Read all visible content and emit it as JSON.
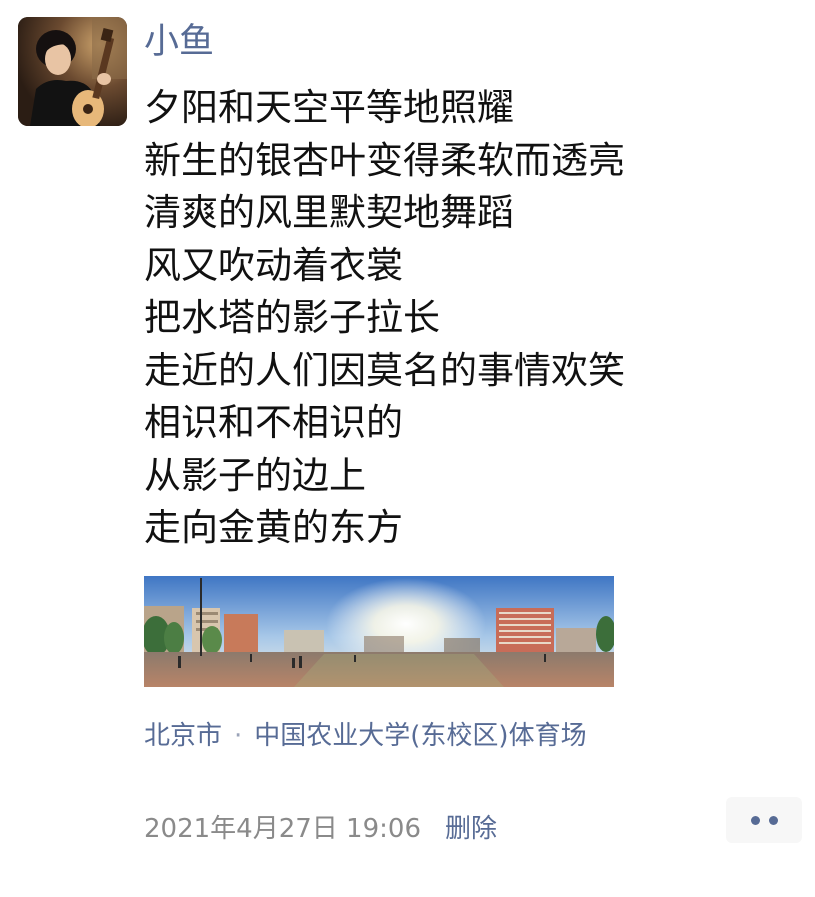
{
  "post": {
    "author": "小鱼",
    "lines": [
      "夕阳和天空平等地照耀",
      "新生的银杏叶变得柔软而透亮",
      "清爽的风里默契地舞蹈",
      "风又吹动着衣裳",
      "把水塔的影子拉长",
      "走近的人们因莫名的事情欢笑",
      "相识和不相识的",
      "从影子的边上",
      "走向金黄的东方"
    ],
    "location": {
      "city": "北京市",
      "separator": "·",
      "place": "中国农业大学(东校区)体育场"
    },
    "timestamp": "2021年4月27日 19:06",
    "delete_label": "删除"
  },
  "icons": {
    "avatar": "avatar-guitar-player",
    "photo": "panorama-sports-field",
    "more": "more-dots-icon"
  },
  "colors": {
    "link": "#576b95",
    "text": "#111111",
    "muted": "#8a8a8a",
    "button_bg": "#f7f7f7"
  }
}
